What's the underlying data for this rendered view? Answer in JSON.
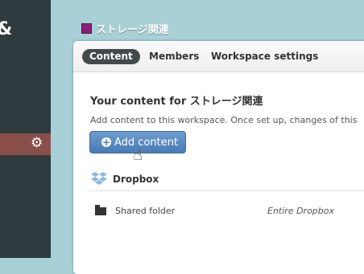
{
  "sidebar": {
    "logo_glyph": "&",
    "settings_icon": "gear-icon"
  },
  "workspace": {
    "name": "ストレージ関連",
    "color": "#8b1e7b"
  },
  "tabs": [
    {
      "label": "Content",
      "active": true
    },
    {
      "label": "Members",
      "active": false
    },
    {
      "label": "Workspace settings",
      "active": false
    }
  ],
  "content": {
    "title": "Your content for ストレージ関連",
    "description": "Add content to this workspace. Once set up, changes of this",
    "add_button": "Add content"
  },
  "provider": {
    "name": "Dropbox",
    "icon": "dropbox-icon"
  },
  "folders": [
    {
      "name": "Shared folder",
      "scope": "Entire Dropbox",
      "icon": "folder-icon"
    }
  ]
}
